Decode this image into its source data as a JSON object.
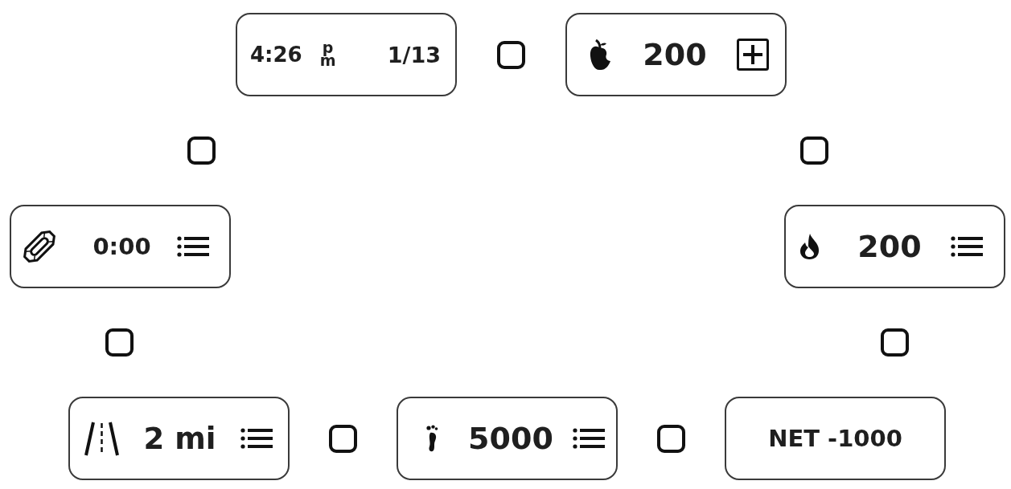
{
  "rows": [
    {
      "items": [
        {
          "kind": "clock",
          "time": "4:26",
          "meridiem": "pm",
          "date": "1/13"
        },
        {
          "kind": "checkbox",
          "checked": false
        },
        {
          "kind": "food",
          "value": "200",
          "add": true
        }
      ]
    },
    {
      "items": [
        {
          "kind": "checkbox",
          "checked": false
        },
        {
          "kind": "checkbox",
          "checked": false
        }
      ]
    },
    {
      "items": [
        {
          "kind": "timer",
          "value": "0:00",
          "menu": true
        },
        {
          "kind": "burn",
          "value": "200",
          "menu": true
        }
      ]
    },
    {
      "items": [
        {
          "kind": "checkbox",
          "checked": false
        },
        {
          "kind": "checkbox",
          "checked": false
        }
      ]
    },
    {
      "items": [
        {
          "kind": "distance",
          "value": "2 mi",
          "menu": true
        },
        {
          "kind": "checkbox",
          "checked": false
        },
        {
          "kind": "steps",
          "value": "5000",
          "menu": true
        },
        {
          "kind": "checkbox",
          "checked": false
        },
        {
          "kind": "net",
          "value": "NET -1000"
        }
      ]
    }
  ]
}
